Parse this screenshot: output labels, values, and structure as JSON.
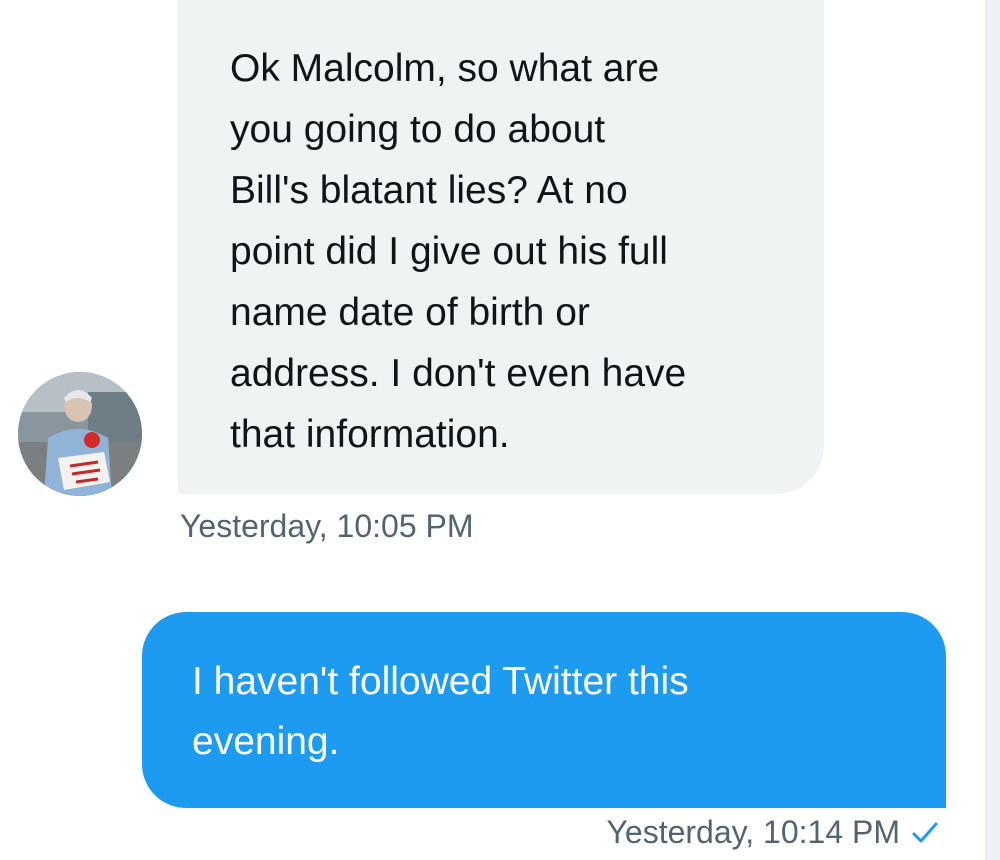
{
  "conversation": {
    "incoming": {
      "avatar_icon": "user-avatar-photo",
      "lines": [
        "Ok Malcolm, so what are",
        "you going to do about",
        "Bill's blatant lies? At no",
        "point did I give out his full",
        "name date of birth or",
        "address. I don't even have",
        "that information."
      ],
      "timestamp": "Yesterday, 10:05 PM",
      "bubble_color": "#eff3f4"
    },
    "outgoing": {
      "lines": [
        "I haven't followed Twitter this",
        "evening."
      ],
      "timestamp": "Yesterday, 10:14 PM",
      "status_icon": "checkmark-icon",
      "bubble_color": "#1d9bf0"
    }
  },
  "colors": {
    "accent": "#1d9bf0",
    "text_primary": "#0f1419",
    "text_secondary": "#536471"
  }
}
